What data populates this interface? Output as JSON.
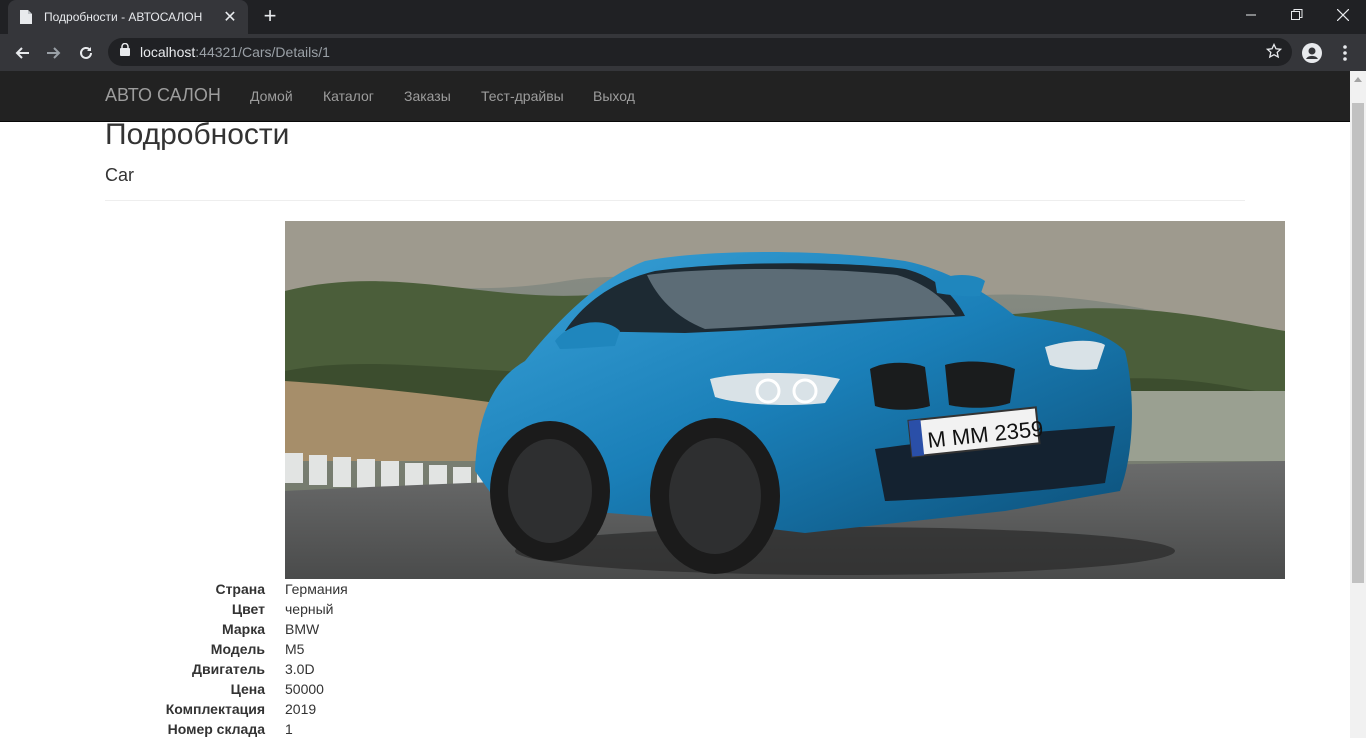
{
  "browser": {
    "tab_title": "Подробности - АВТОСАЛОН",
    "url_host": "localhost",
    "url_rest": ":44321/Cars/Details/1"
  },
  "navbar": {
    "brand": "АВТО САЛОН",
    "links": [
      "Домой",
      "Каталог",
      "Заказы",
      "Тест-драйвы",
      "Выход"
    ]
  },
  "page": {
    "title": "Подробности",
    "subtitle": "Car",
    "image_icon": "car-photo-blue-bmw"
  },
  "details": [
    {
      "label": "Страна",
      "value": "Германия"
    },
    {
      "label": "Цвет",
      "value": "черный"
    },
    {
      "label": "Марка",
      "value": "BMW"
    },
    {
      "label": "Модель",
      "value": "M5"
    },
    {
      "label": "Двигатель",
      "value": "3.0D"
    },
    {
      "label": "Цена",
      "value": "50000"
    },
    {
      "label": "Комплектация",
      "value": "2019"
    },
    {
      "label": "Номер склада",
      "value": "1"
    }
  ],
  "license_plate": "M MM 2359",
  "colors": {
    "navbar_bg": "#222222",
    "navbar_link": "#9d9d9d",
    "car_blue": "#1e7fb6"
  }
}
